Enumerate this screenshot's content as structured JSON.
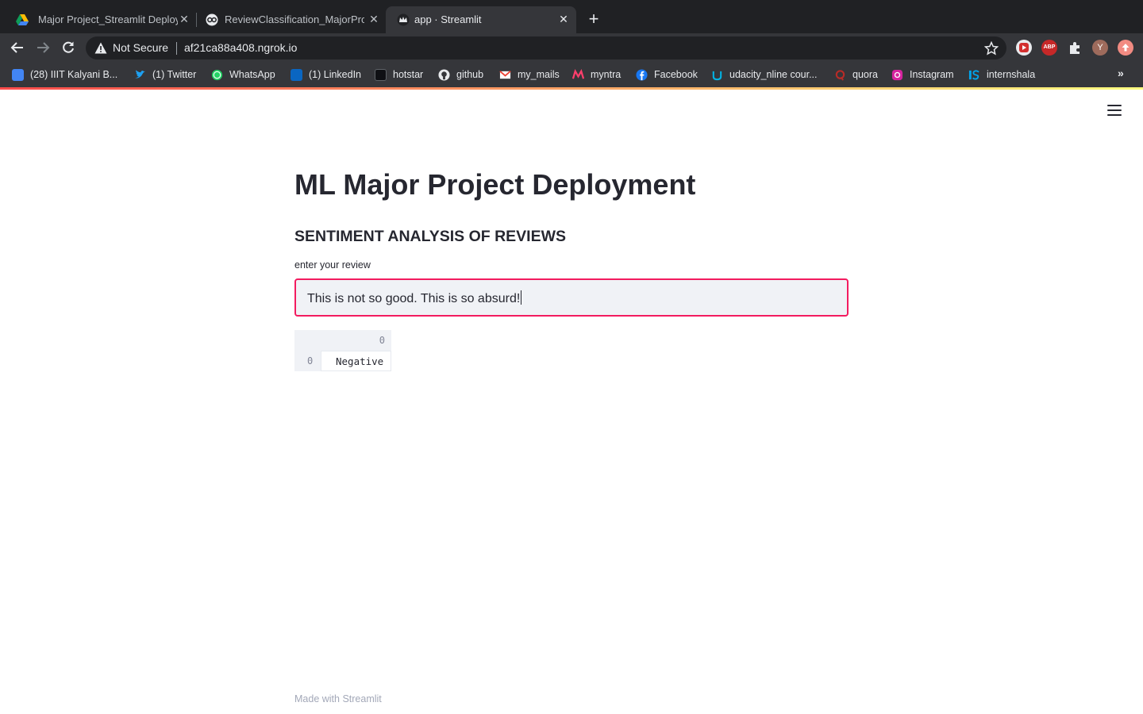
{
  "browser": {
    "tabs": [
      {
        "title": "Major Project_Streamlit Deploy",
        "icon": "google-drive-icon"
      },
      {
        "title": "ReviewClassification_MajorProj",
        "icon": "colab-icon"
      },
      {
        "title": "app · Streamlit",
        "icon": "streamlit-crown-icon",
        "active": true
      }
    ],
    "close_glyph": "✕",
    "new_tab_glyph": "+",
    "omnibox": {
      "security_label": "Not Secure",
      "url": "af21ca88a408.ngrok.io"
    },
    "bookmarks": [
      {
        "label": "(28) IIIT Kalyani B...",
        "icon": "chat-icon"
      },
      {
        "label": "(1) Twitter",
        "icon": "twitter-icon"
      },
      {
        "label": "WhatsApp",
        "icon": "whatsapp-icon"
      },
      {
        "label": "(1) LinkedIn",
        "icon": "linkedin-icon"
      },
      {
        "label": "hotstar",
        "icon": "hotstar-icon"
      },
      {
        "label": "github",
        "icon": "github-icon"
      },
      {
        "label": "my_mails",
        "icon": "gmail-icon"
      },
      {
        "label": "myntra",
        "icon": "myntra-icon"
      },
      {
        "label": "Facebook",
        "icon": "facebook-icon"
      },
      {
        "label": "udacity_nline cour...",
        "icon": "udacity-icon"
      },
      {
        "label": "quora",
        "icon": "quora-icon"
      },
      {
        "label": "Instagram",
        "icon": "instagram-icon"
      },
      {
        "label": "internshala",
        "icon": "internshala-icon"
      }
    ],
    "bookmarks_more": "»",
    "extensions": [
      {
        "icon": "screencast-ext-icon",
        "text": ""
      },
      {
        "icon": "adblock-plus-icon",
        "text": "ABP"
      },
      {
        "icon": "puzzle-extensions-icon",
        "text": ""
      },
      {
        "icon": "profile-avatar-icon",
        "text": "Y"
      },
      {
        "icon": "update-icon",
        "text": ""
      }
    ]
  },
  "app": {
    "title": "ML Major Project Deployment",
    "subheader": "SENTIMENT ANALYSIS OF REVIEWS",
    "input_label": "enter your review",
    "input_value": "This is not so good. This is so absurd!",
    "dataframe": {
      "columns": [
        "0"
      ],
      "index": [
        "0"
      ],
      "rows": [
        [
          "Negative"
        ]
      ]
    },
    "footer": "Made with Streamlit"
  },
  "colors": {
    "accent": "#f31b5f",
    "text": "#262730",
    "chrome_dark": "#202124",
    "chrome_toolbar": "#35363a"
  }
}
